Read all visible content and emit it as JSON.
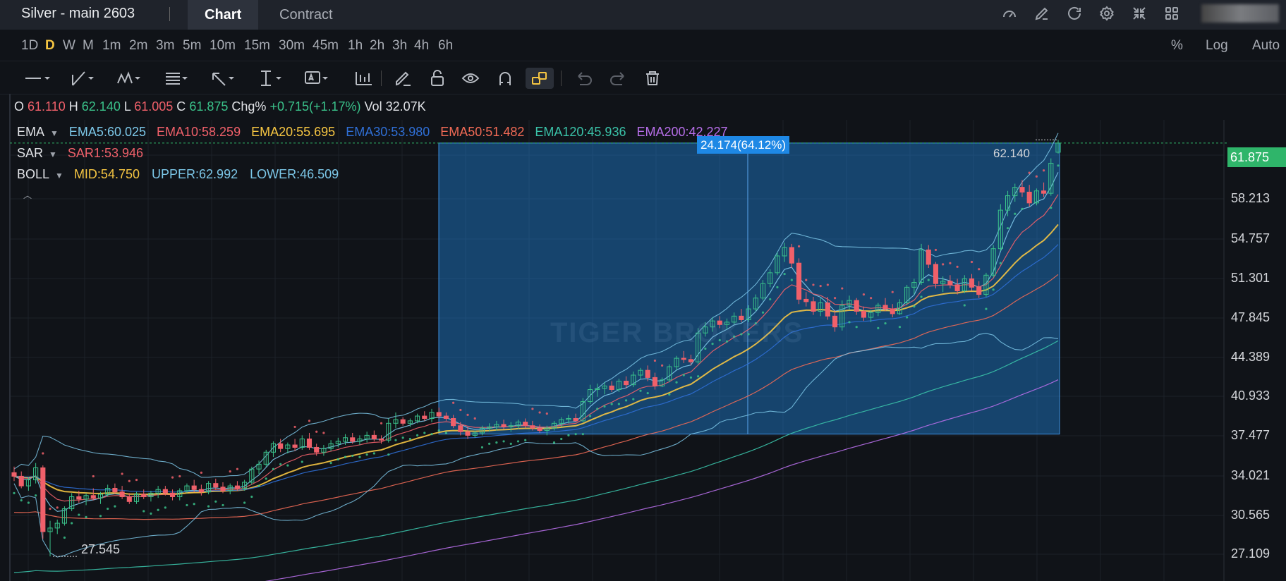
{
  "header": {
    "instrument": "Silver - main 2603",
    "tabs": [
      {
        "label": "Chart",
        "active": true
      },
      {
        "label": "Contract",
        "active": false
      }
    ],
    "icons": [
      "gauge-icon",
      "edit-icon",
      "refresh-icon",
      "settings-icon",
      "collapse-icon",
      "grid-icon"
    ]
  },
  "timeframes": {
    "items": [
      "1D",
      "D",
      "W",
      "M",
      "1m",
      "2m",
      "3m",
      "5m",
      "10m",
      "15m",
      "30m",
      "45m",
      "1h",
      "2h",
      "3h",
      "4h",
      "6h"
    ],
    "selected": "D",
    "right": [
      "%",
      "Log",
      "Auto"
    ]
  },
  "toolbar": {
    "tools": [
      "line-tool-icon",
      "trend-tool-icon",
      "pattern-tool-icon",
      "fib-tool-icon",
      "arrow-tool-icon",
      "measure-tool-icon",
      "text-tool-icon",
      "indicator-icon",
      "pencil-icon",
      "lock-icon",
      "eye-icon",
      "magnet-icon",
      "link-icon",
      "undo-icon",
      "redo-icon",
      "trash-icon"
    ],
    "highlighted": "link-icon"
  },
  "ohlc": {
    "o_label": "O",
    "o": "61.110",
    "h_label": "H",
    "h": "62.140",
    "l_label": "L",
    "l": "61.005",
    "c_label": "C",
    "c": "61.875",
    "chg_label": "Chg%",
    "chg": "+0.715(+1.17%)",
    "vol_label": "Vol",
    "vol": "32.07K"
  },
  "indicators": {
    "ema": {
      "name": "EMA",
      "values": [
        {
          "text": "EMA5:60.025",
          "color": "#7cc7e8"
        },
        {
          "text": "EMA10:58.259",
          "color": "#f0606a"
        },
        {
          "text": "EMA20:55.695",
          "color": "#f5c542"
        },
        {
          "text": "EMA30:53.980",
          "color": "#2f6fd6"
        },
        {
          "text": "EMA50:51.482",
          "color": "#f06a55"
        },
        {
          "text": "EMA120:45.936",
          "color": "#3ac2a8"
        },
        {
          "text": "EMA200:42.227",
          "color": "#b66ee8"
        }
      ]
    },
    "sar": {
      "name": "SAR",
      "value": "SAR1:53.946",
      "color": "#f0606a"
    },
    "boll": {
      "name": "BOLL",
      "mid": "MID:54.750",
      "upper": "UPPER:62.992",
      "lower": "LOWER:46.509",
      "mid_color": "#f5c542",
      "band_color": "#7cc7e8"
    }
  },
  "price_axis": [
    "61.875",
    "58.213",
    "54.757",
    "51.301",
    "47.845",
    "44.389",
    "40.933",
    "37.477",
    "34.021",
    "30.565",
    "27.109"
  ],
  "last_price": "61.875",
  "measure_label": "24.174(64.12%)",
  "high_label": "62.140",
  "low_label": "27.545",
  "watermark": "TIGER BROKERS",
  "colors": {
    "up": "#3ac28a",
    "down": "#f0606a",
    "bg": "#101318",
    "measure": "#1e88e5"
  },
  "chart_data": {
    "type": "candlestick",
    "title": "Silver - main 2603",
    "ylim": [
      25.5,
      63.8
    ],
    "last_close": 61.875,
    "high": 62.14,
    "low": 27.545,
    "measure": {
      "from": 37.7,
      "to": 61.875,
      "change": 24.174,
      "pct": 64.12
    },
    "ohlc": [
      [
        34.5,
        35.0,
        33.8,
        34.2
      ],
      [
        34.2,
        34.6,
        33.2,
        33.4
      ],
      [
        33.4,
        34.1,
        33.0,
        33.9
      ],
      [
        33.9,
        35.3,
        33.6,
        34.9
      ],
      [
        34.9,
        35.1,
        29.0,
        29.6
      ],
      [
        29.6,
        30.5,
        27.545,
        29.9
      ],
      [
        29.9,
        30.6,
        29.4,
        30.3
      ],
      [
        30.3,
        31.7,
        30.1,
        31.5
      ],
      [
        31.5,
        32.8,
        31.3,
        32.5
      ],
      [
        32.5,
        33.0,
        32.0,
        32.3
      ],
      [
        32.3,
        32.8,
        31.8,
        32.6
      ],
      [
        32.6,
        33.2,
        32.2,
        32.4
      ],
      [
        32.4,
        32.9,
        31.9,
        32.7
      ],
      [
        32.7,
        33.5,
        32.5,
        33.2
      ],
      [
        33.2,
        33.6,
        32.7,
        32.9
      ],
      [
        32.9,
        33.4,
        32.3,
        32.5
      ],
      [
        32.5,
        32.8,
        31.9,
        32.1
      ],
      [
        32.1,
        32.9,
        31.9,
        32.7
      ],
      [
        32.7,
        33.1,
        32.3,
        32.5
      ],
      [
        32.5,
        33.0,
        32.1,
        32.8
      ],
      [
        32.8,
        33.4,
        32.4,
        33.1
      ],
      [
        33.1,
        33.4,
        32.6,
        32.8
      ],
      [
        32.8,
        33.1,
        32.2,
        32.5
      ],
      [
        32.5,
        33.2,
        32.2,
        33.0
      ],
      [
        33.0,
        33.6,
        32.8,
        33.4
      ],
      [
        33.4,
        33.9,
        32.9,
        33.1
      ],
      [
        33.1,
        33.5,
        32.6,
        32.9
      ],
      [
        32.9,
        33.8,
        32.7,
        33.6
      ],
      [
        33.6,
        34.0,
        33.1,
        33.3
      ],
      [
        33.3,
        33.7,
        32.8,
        33.0
      ],
      [
        33.0,
        33.6,
        32.7,
        33.4
      ],
      [
        33.4,
        33.8,
        33.0,
        33.2
      ],
      [
        33.2,
        33.9,
        33.0,
        33.7
      ],
      [
        33.7,
        35.0,
        33.5,
        34.8
      ],
      [
        34.8,
        35.5,
        34.4,
        35.2
      ],
      [
        35.2,
        36.4,
        35.0,
        36.2
      ],
      [
        36.2,
        37.1,
        35.8,
        36.9
      ],
      [
        36.9,
        37.3,
        36.2,
        36.5
      ],
      [
        36.5,
        37.0,
        36.1,
        36.8
      ],
      [
        36.8,
        37.3,
        36.3,
        36.6
      ],
      [
        36.6,
        37.6,
        36.4,
        37.3
      ],
      [
        37.3,
        37.8,
        36.4,
        36.6
      ],
      [
        36.6,
        36.9,
        35.9,
        36.2
      ],
      [
        36.2,
        36.8,
        35.9,
        36.5
      ],
      [
        36.5,
        37.2,
        36.3,
        36.9
      ],
      [
        36.9,
        37.4,
        36.6,
        37.1
      ],
      [
        37.1,
        37.7,
        36.8,
        37.4
      ],
      [
        37.4,
        37.8,
        36.9,
        37.1
      ],
      [
        37.1,
        37.6,
        36.8,
        37.3
      ],
      [
        37.3,
        37.9,
        37.0,
        37.6
      ],
      [
        37.6,
        38.0,
        37.1,
        37.3
      ],
      [
        37.3,
        37.6,
        36.9,
        37.2
      ],
      [
        37.2,
        39.0,
        37.0,
        38.6
      ],
      [
        38.6,
        39.5,
        38.2,
        38.9
      ],
      [
        38.9,
        39.1,
        38.4,
        38.6
      ],
      [
        38.6,
        39.0,
        38.3,
        38.8
      ],
      [
        38.8,
        39.4,
        38.6,
        39.2
      ],
      [
        39.2,
        39.6,
        38.8,
        39.0
      ],
      [
        39.0,
        39.8,
        38.7,
        39.5
      ],
      [
        39.5,
        39.9,
        39.0,
        39.2
      ],
      [
        39.2,
        39.5,
        38.8,
        39.0
      ],
      [
        39.0,
        39.3,
        38.2,
        38.4
      ],
      [
        38.4,
        38.7,
        37.6,
        37.9
      ],
      [
        37.9,
        38.3,
        37.3,
        37.6
      ],
      [
        37.6,
        38.0,
        37.4,
        37.8
      ],
      [
        37.8,
        38.4,
        37.6,
        38.2
      ],
      [
        38.2,
        38.6,
        37.9,
        38.3
      ],
      [
        38.3,
        38.8,
        38.0,
        38.5
      ],
      [
        38.5,
        38.9,
        38.1,
        38.3
      ],
      [
        38.3,
        38.7,
        37.9,
        38.4
      ],
      [
        38.4,
        38.9,
        38.1,
        38.7
      ],
      [
        38.7,
        39.0,
        38.2,
        38.4
      ],
      [
        38.4,
        38.8,
        38.0,
        38.2
      ],
      [
        38.2,
        38.5,
        37.8,
        38.0
      ],
      [
        38.0,
        38.4,
        37.6,
        38.2
      ],
      [
        38.2,
        38.8,
        38.0,
        38.6
      ],
      [
        38.6,
        39.1,
        38.3,
        38.9
      ],
      [
        38.9,
        39.3,
        38.6,
        39.0
      ],
      [
        39.0,
        39.4,
        38.7,
        38.8
      ],
      [
        38.8,
        40.7,
        38.7,
        40.4
      ],
      [
        40.4,
        41.8,
        40.2,
        41.4
      ],
      [
        41.4,
        41.9,
        40.8,
        41.5
      ],
      [
        41.5,
        42.0,
        41.0,
        41.7
      ],
      [
        41.7,
        42.1,
        41.2,
        41.4
      ],
      [
        41.4,
        42.3,
        41.2,
        42.1
      ],
      [
        42.1,
        42.5,
        41.5,
        41.8
      ],
      [
        41.8,
        42.9,
        41.6,
        42.6
      ],
      [
        42.6,
        43.2,
        42.3,
        43.0
      ],
      [
        43.0,
        43.4,
        42.1,
        42.4
      ],
      [
        42.4,
        42.8,
        41.4,
        41.7
      ],
      [
        41.7,
        42.4,
        41.6,
        42.2
      ],
      [
        42.2,
        43.5,
        42.0,
        43.3
      ],
      [
        43.3,
        44.2,
        43.0,
        44.0
      ],
      [
        44.0,
        44.6,
        43.6,
        43.9
      ],
      [
        43.9,
        44.3,
        43.4,
        43.7
      ],
      [
        43.7,
        46.5,
        43.5,
        46.1
      ],
      [
        46.1,
        47.0,
        45.8,
        46.6
      ],
      [
        46.6,
        47.4,
        46.2,
        47.1
      ],
      [
        47.1,
        47.5,
        46.5,
        46.8
      ],
      [
        46.8,
        47.3,
        46.4,
        47.0
      ],
      [
        47.0,
        47.8,
        46.8,
        47.5
      ],
      [
        47.5,
        48.1,
        47.0,
        47.2
      ],
      [
        47.2,
        48.4,
        47.0,
        48.1
      ],
      [
        48.1,
        49.3,
        47.9,
        49.0
      ],
      [
        49.0,
        50.5,
        48.8,
        50.2
      ],
      [
        50.2,
        51.4,
        49.9,
        51.1
      ],
      [
        51.1,
        52.8,
        50.9,
        52.5
      ],
      [
        52.5,
        53.6,
        52.0,
        53.2
      ],
      [
        53.2,
        53.5,
        51.5,
        51.9
      ],
      [
        51.9,
        52.3,
        48.5,
        48.9
      ],
      [
        48.9,
        49.5,
        48.3,
        48.7
      ],
      [
        48.7,
        49.1,
        47.6,
        47.9
      ],
      [
        47.9,
        49.0,
        47.5,
        48.6
      ],
      [
        48.6,
        49.1,
        47.2,
        47.5
      ],
      [
        47.5,
        48.0,
        46.2,
        46.6
      ],
      [
        46.6,
        48.8,
        46.3,
        48.4
      ],
      [
        48.4,
        49.2,
        48.0,
        48.8
      ],
      [
        48.8,
        49.0,
        47.6,
        47.9
      ],
      [
        47.9,
        48.3,
        47.1,
        47.4
      ],
      [
        47.4,
        48.0,
        47.0,
        47.8
      ],
      [
        47.8,
        48.6,
        47.5,
        48.4
      ],
      [
        48.4,
        49.0,
        47.9,
        48.1
      ],
      [
        48.1,
        48.5,
        47.4,
        47.7
      ],
      [
        47.7,
        48.9,
        47.6,
        48.6
      ],
      [
        48.6,
        50.1,
        48.4,
        49.9
      ],
      [
        49.9,
        50.6,
        49.3,
        50.3
      ],
      [
        50.3,
        53.5,
        50.1,
        53.0
      ],
      [
        53.0,
        53.4,
        51.5,
        51.8
      ],
      [
        51.8,
        52.0,
        49.8,
        50.2
      ],
      [
        50.2,
        50.8,
        49.5,
        50.4
      ],
      [
        50.4,
        50.9,
        49.8,
        50.1
      ],
      [
        50.1,
        50.6,
        49.3,
        49.6
      ],
      [
        49.6,
        50.9,
        49.4,
        50.6
      ],
      [
        50.6,
        51.0,
        49.6,
        49.9
      ],
      [
        49.9,
        50.4,
        49.0,
        49.3
      ],
      [
        49.3,
        51.1,
        49.1,
        50.9
      ],
      [
        50.9,
        53.4,
        50.7,
        53.1
      ],
      [
        53.1,
        56.8,
        52.9,
        56.3
      ],
      [
        56.3,
        57.9,
        55.8,
        57.5
      ],
      [
        57.5,
        58.5,
        57.0,
        58.2
      ],
      [
        58.2,
        58.8,
        57.4,
        57.8
      ],
      [
        57.8,
        58.4,
        56.6,
        56.9
      ],
      [
        56.9,
        58.1,
        56.7,
        57.9
      ],
      [
        57.9,
        58.6,
        57.4,
        57.7
      ],
      [
        57.7,
        60.6,
        57.5,
        60.2
      ],
      [
        61.11,
        62.14,
        61.005,
        61.875
      ]
    ],
    "series": [
      {
        "name": "EMA5",
        "color": "#7cc7e8"
      },
      {
        "name": "EMA10",
        "color": "#f0606a"
      },
      {
        "name": "EMA20",
        "color": "#f5c542"
      },
      {
        "name": "EMA30",
        "color": "#2f6fd6"
      },
      {
        "name": "EMA50",
        "color": "#f06a55"
      },
      {
        "name": "EMA120",
        "color": "#3ac2a8"
      },
      {
        "name": "EMA200",
        "color": "#b66ee8"
      },
      {
        "name": "BOLL",
        "color": "#7cc7e8"
      },
      {
        "name": "SAR",
        "color": "#f0606a"
      }
    ]
  }
}
